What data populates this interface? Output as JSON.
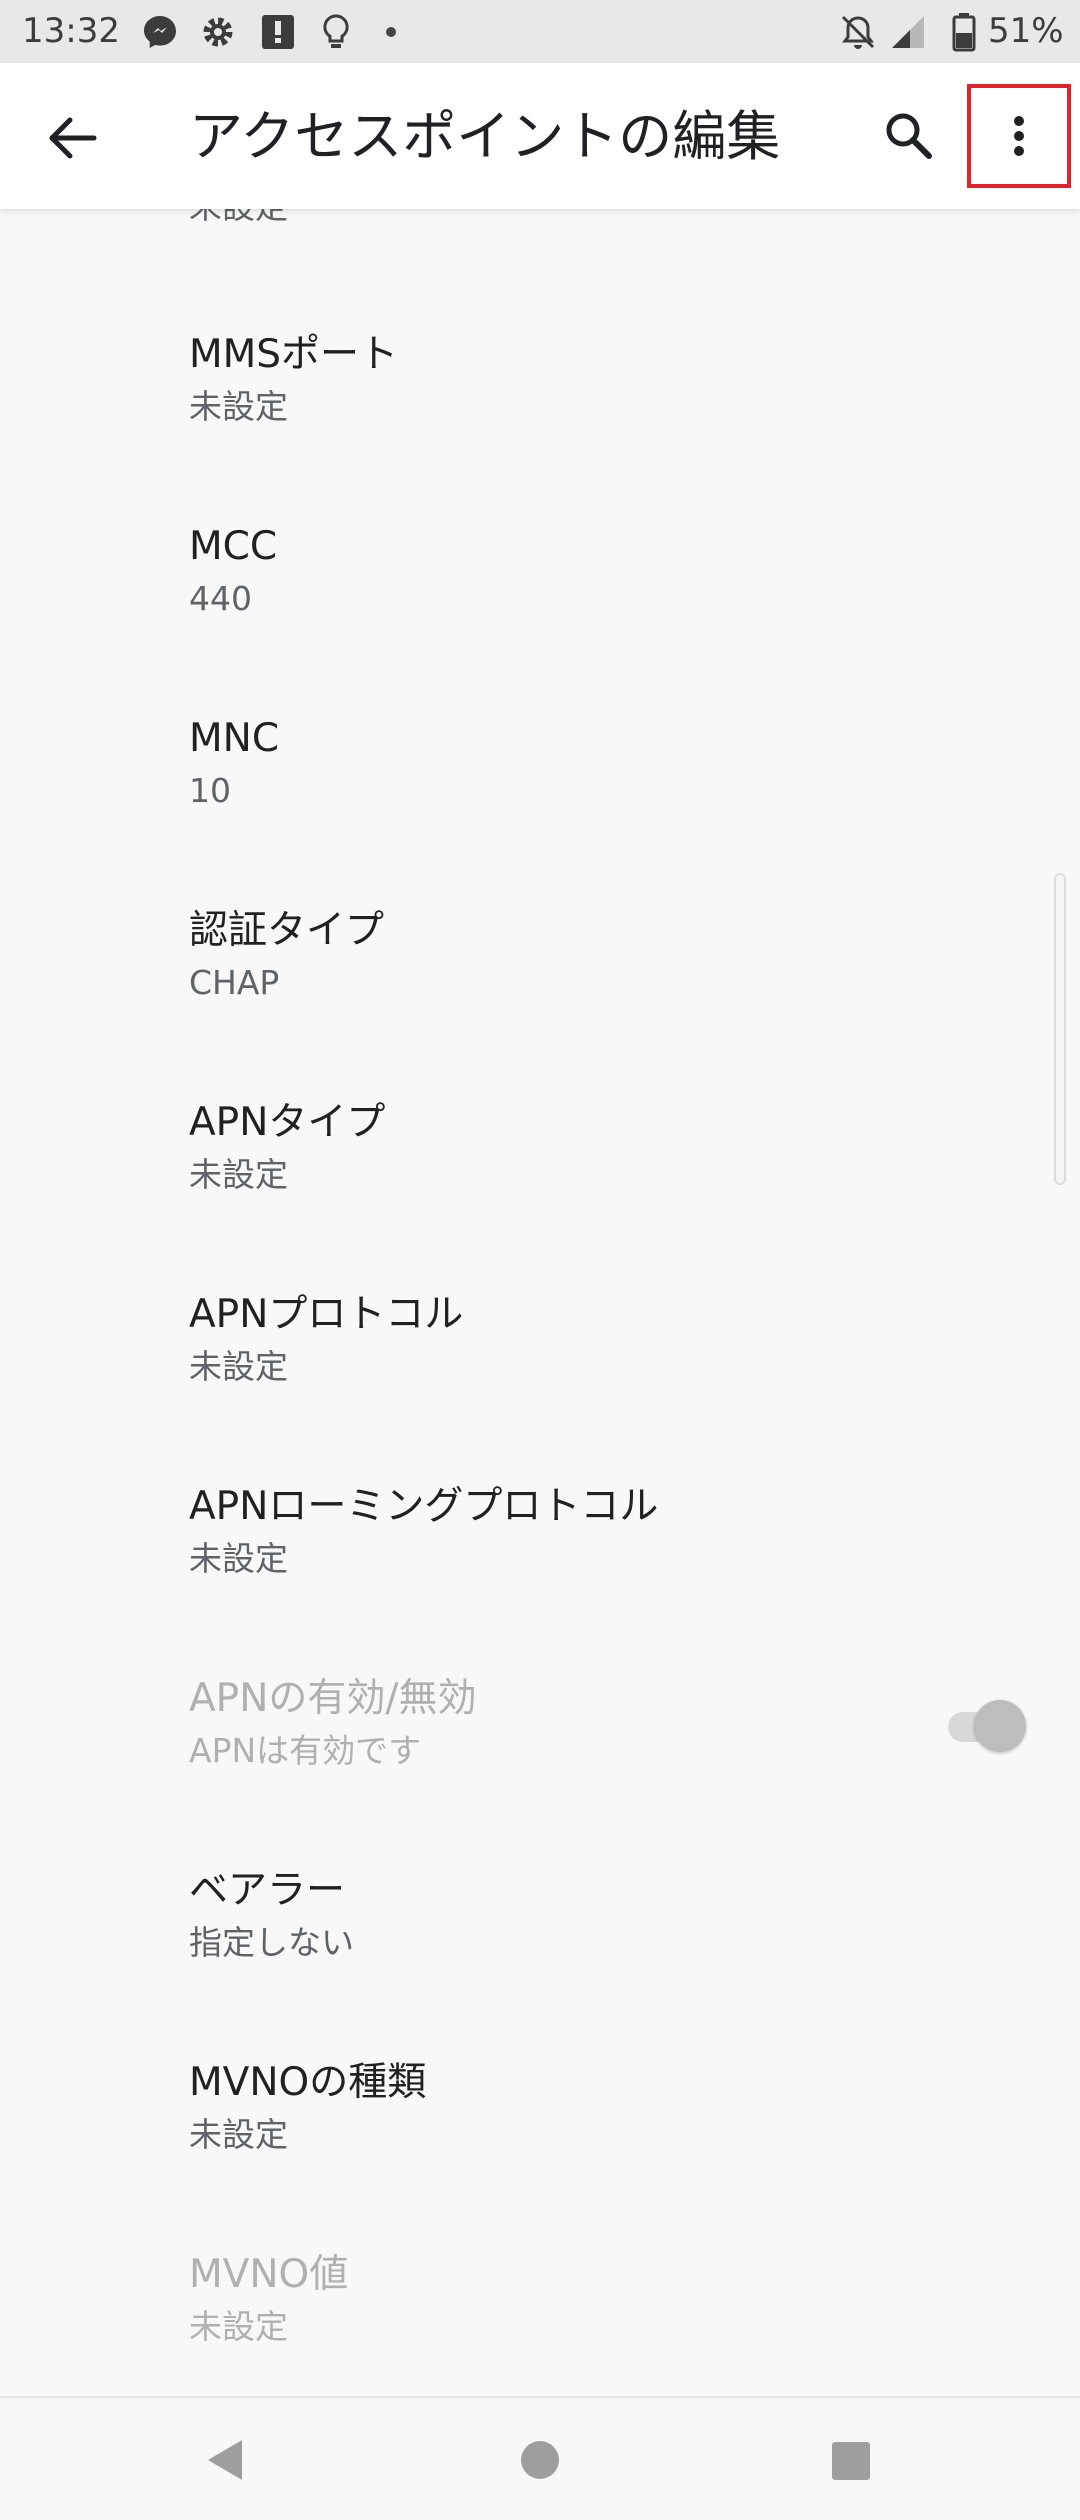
{
  "status_bar": {
    "time": "13:32",
    "battery": "51%",
    "icons": [
      "messenger-icon",
      "gear-icon",
      "sim-alert-icon",
      "lightbulb-icon",
      "notification-dot",
      "alarm-off-icon",
      "signal-icon",
      "battery-icon"
    ]
  },
  "app_bar": {
    "title": "アクセスポイントの編集",
    "back_icon": "arrow-back-icon",
    "search_icon": "search-icon",
    "more_icon": "more-vert-icon",
    "highlight_color": "#e0222b"
  },
  "list": {
    "partial_top_summary": "未設定",
    "items": [
      {
        "title": "MMSポート",
        "summary": "未設定"
      },
      {
        "title": "MCC",
        "summary": "440"
      },
      {
        "title": "MNC",
        "summary": "10"
      },
      {
        "title": "認証タイプ",
        "summary": "CHAP"
      },
      {
        "title": "APNタイプ",
        "summary": "未設定"
      },
      {
        "title": "APNプロトコル",
        "summary": "未設定"
      },
      {
        "title": "APNローミングプロトコル",
        "summary": "未設定"
      },
      {
        "title": "APNの有効/無効",
        "summary": "APNは有効です",
        "disabled": true,
        "toggle": "on"
      },
      {
        "title": "ベアラー",
        "summary": "指定しない"
      },
      {
        "title": "MVNOの種類",
        "summary": "未設定"
      },
      {
        "title": "MVNO値",
        "summary": "未設定",
        "disabled": true
      }
    ]
  },
  "nav_bar": {
    "back": "nav-back-icon",
    "home": "nav-home-icon",
    "recents": "nav-recents-icon"
  }
}
